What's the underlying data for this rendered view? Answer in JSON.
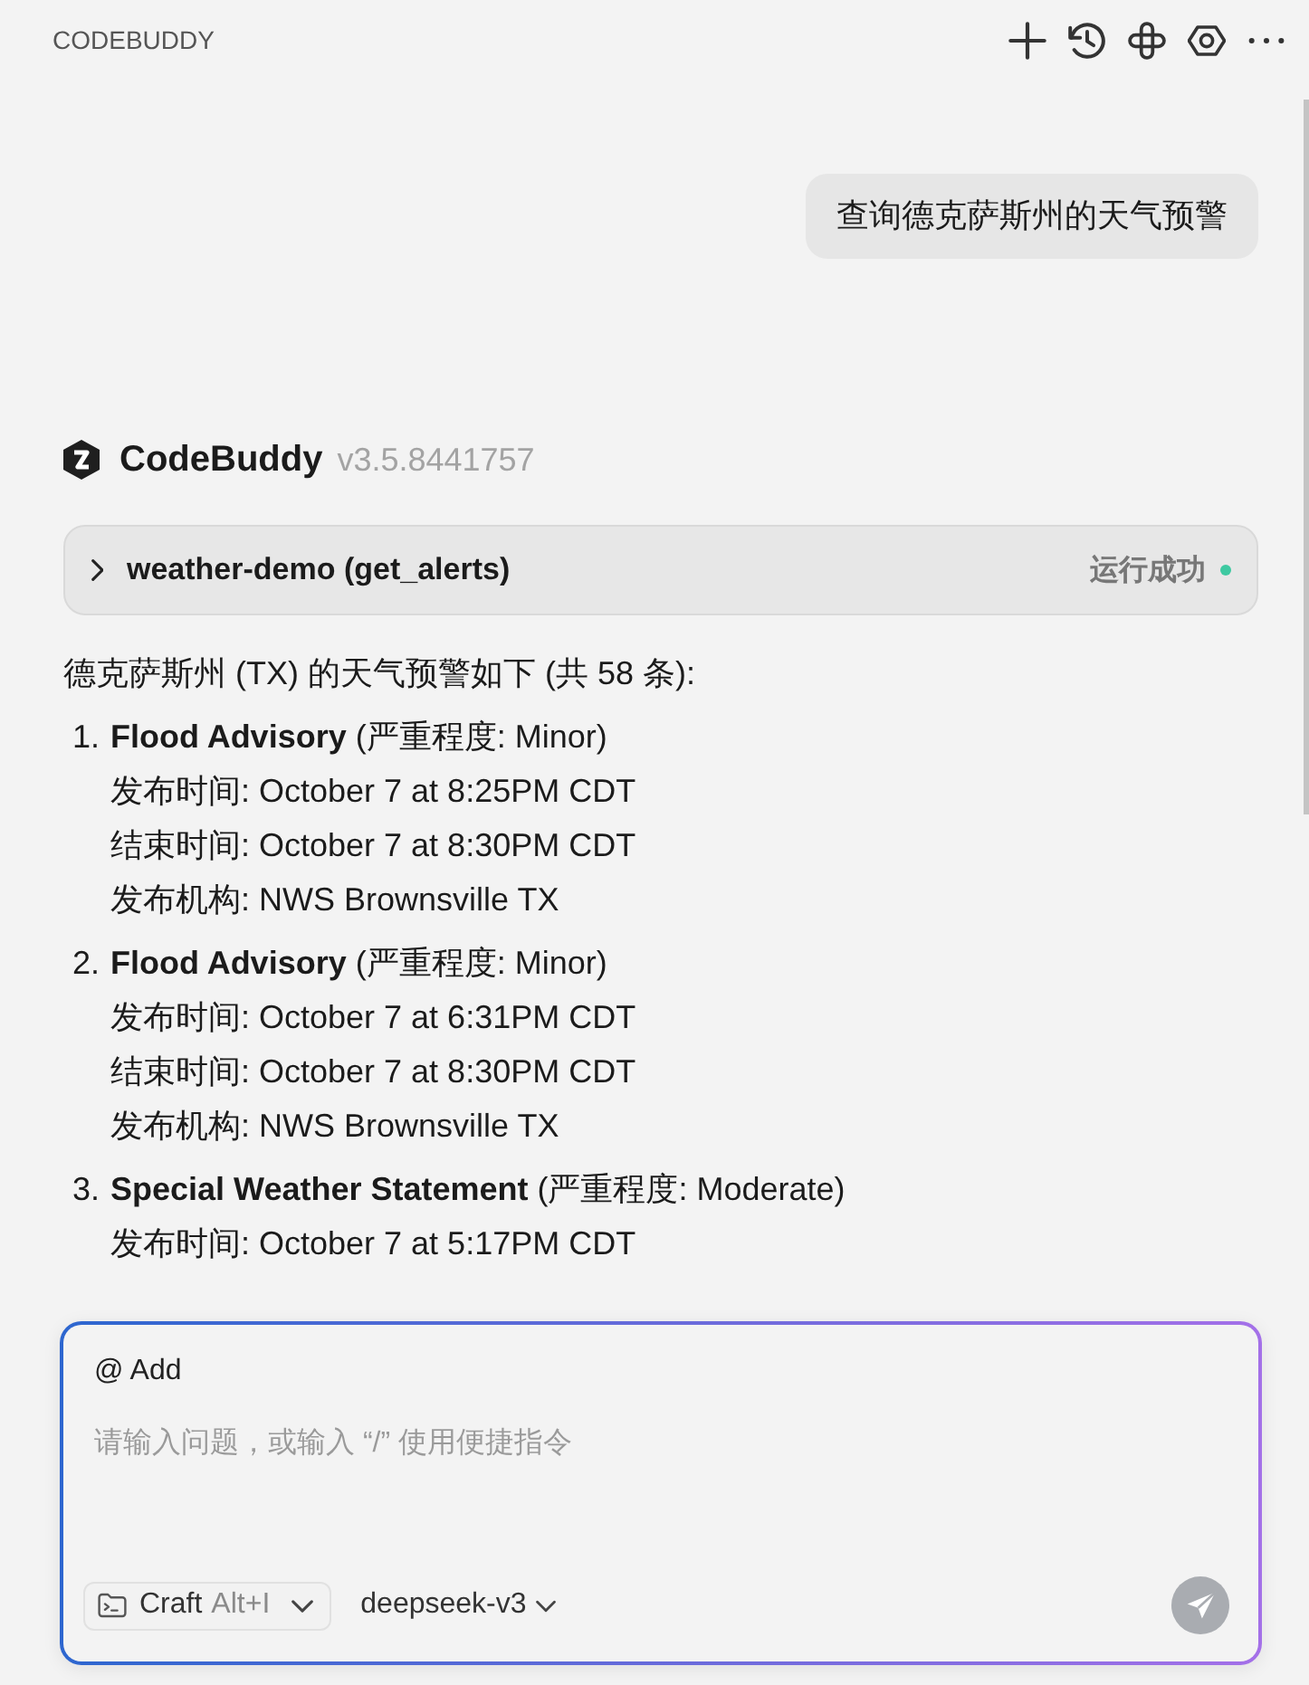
{
  "header": {
    "title": "CODEBUDDY"
  },
  "user_message": {
    "text": "查询德克萨斯州的天气预警"
  },
  "assistant": {
    "name": "CodeBuddy",
    "version": "v3.5.8441757"
  },
  "tool_call": {
    "label": "weather-demo (get_alerts)",
    "expanded": false,
    "status": "运行成功"
  },
  "response": {
    "intro": "德克萨斯州 (TX) 的天气预警如下 (共 58 条):",
    "alerts": [
      {
        "number": "1.",
        "heading": "**Flood Advisory** (严重程度: Minor)",
        "details": [
          "发布时间: October 7 at 8:25PM CDT",
          "结束时间: October 7 at 8:30PM CDT",
          "发布机构: NWS Brownsville TX"
        ]
      },
      {
        "number": "2.",
        "heading": "**Flood Advisory** (严重程度: Minor)",
        "details": [
          "发布时间: October 7 at 6:31PM CDT",
          "结束时间: October 7 at 8:30PM CDT",
          "发布机构: NWS Brownsville TX"
        ]
      },
      {
        "number": "3.",
        "heading": "**Special Weather Statement** (严重程度: Moderate)",
        "details": [
          "发布时间: October 7 at 5:17PM CDT"
        ]
      }
    ]
  },
  "composer": {
    "add_label": "@ Add",
    "placeholder": "请输入问题，或输入 “/” 使用便捷指令",
    "mode": "Craft",
    "mode_shortcut": "Alt+I",
    "model": "deepseek-v3"
  }
}
